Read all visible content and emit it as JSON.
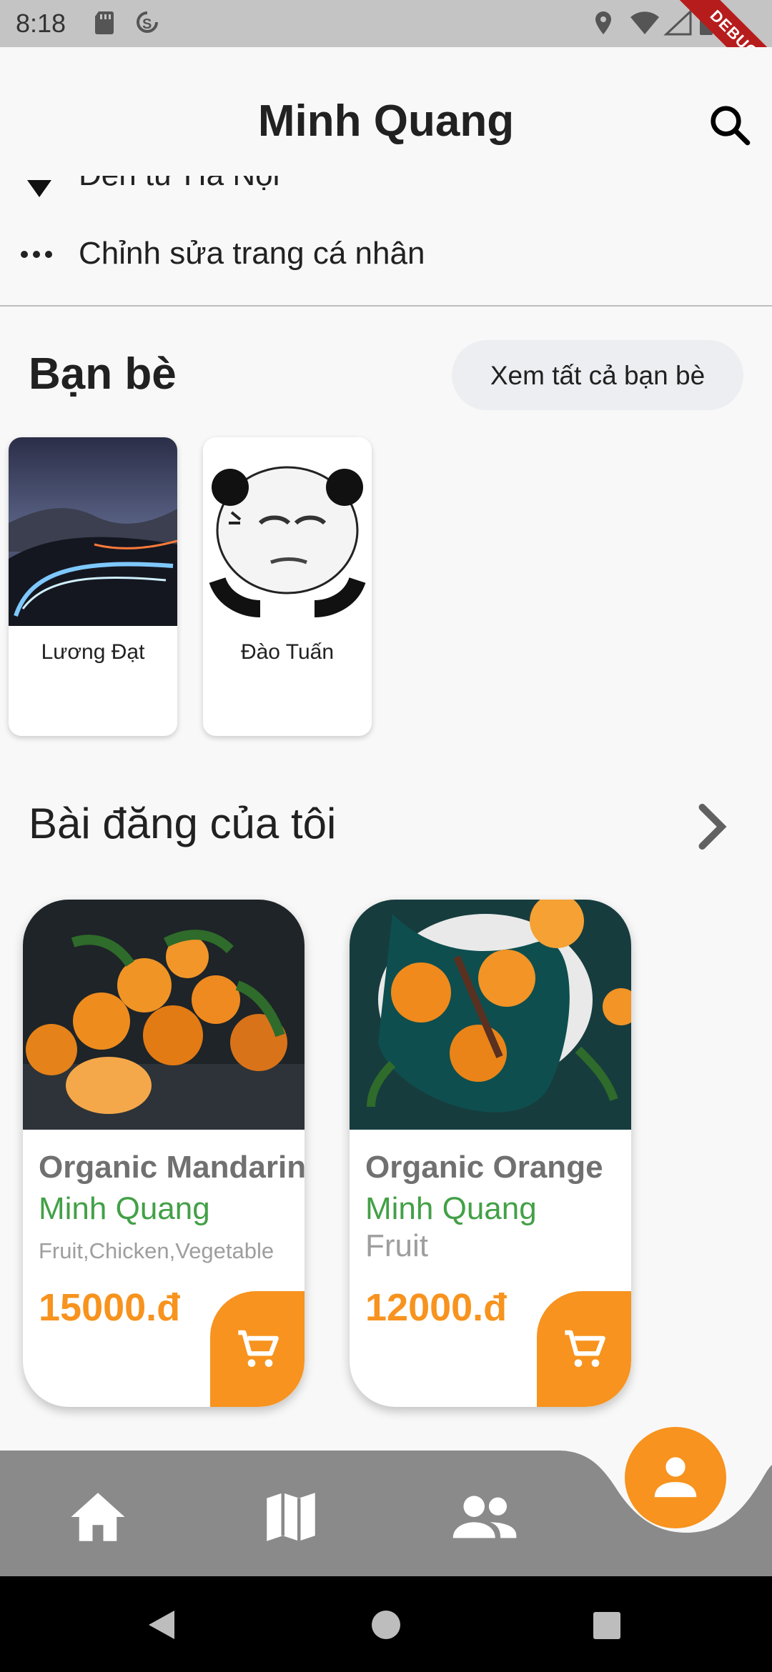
{
  "status_bar": {
    "time": "8:18",
    "debug_label": "DEBUG"
  },
  "header": {
    "title": "Minh Quang",
    "search_icon": "search-icon"
  },
  "profile": {
    "from_label": "Đến từ Hà Nội",
    "edit_label": "Chỉnh sửa trang cá nhân"
  },
  "friends": {
    "title": "Bạn bè",
    "see_all_label": "Xem tất cả bạn bè",
    "items": [
      {
        "name": "Lương Đạt"
      },
      {
        "name": "Đào Tuấn"
      }
    ]
  },
  "posts": {
    "title": "Bài đăng của tôi",
    "items": [
      {
        "name": "Organic Mandarin",
        "seller": "Minh Quang",
        "category": "Fruit,Chicken,Vegetable",
        "price": "15000.đ"
      },
      {
        "name": "Organic Orange",
        "seller": "Minh Quang",
        "category": "Fruit",
        "price": "12000.đ"
      }
    ]
  },
  "bottom_nav": {
    "items": [
      "home-icon",
      "map-icon",
      "people-icon",
      "person-icon"
    ],
    "active": "person-icon"
  },
  "colors": {
    "accent": "#f7931e",
    "seller_green": "#43a047",
    "nav_bg": "#8a8a8a"
  }
}
